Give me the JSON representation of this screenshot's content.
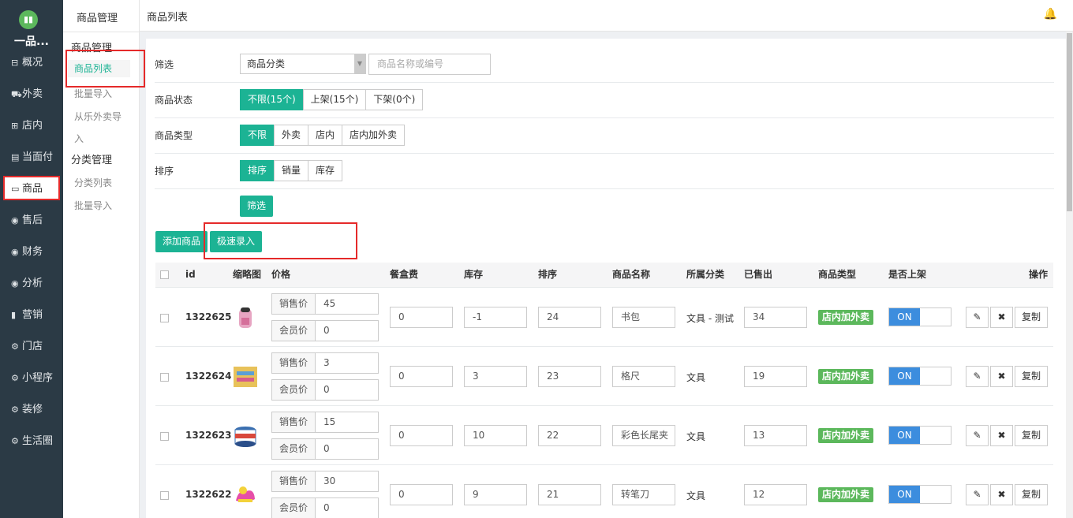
{
  "sidebar": {
    "logo_text": "▮▮",
    "brand": "一品...",
    "items": [
      {
        "icon": "⊟",
        "label": "概况"
      },
      {
        "icon": "⛟",
        "label": "外卖"
      },
      {
        "icon": "⊞",
        "label": "店内"
      },
      {
        "icon": "▤",
        "label": "当面付"
      },
      {
        "icon": "▭",
        "label": "商品"
      },
      {
        "icon": "◉",
        "label": "售后"
      },
      {
        "icon": "◉",
        "label": "财务"
      },
      {
        "icon": "◉",
        "label": "分析"
      },
      {
        "icon": "▮",
        "label": "营销"
      },
      {
        "icon": "⚙",
        "label": "门店"
      },
      {
        "icon": "⚙",
        "label": "小程序"
      },
      {
        "icon": "⚙",
        "label": "装修"
      },
      {
        "icon": "⚙",
        "label": "生活圈"
      }
    ]
  },
  "subnav": {
    "title": "商品管理",
    "group1": "商品管理",
    "active_item": "商品列表",
    "item_import": "批量导入",
    "item_from_lele_1": "从乐外卖导",
    "item_from_lele_2": "入",
    "group2": "分类管理",
    "item_category_list": "分类列表",
    "item_import2": "批量导入"
  },
  "topbar": {
    "title": "商品列表",
    "bell": "🔔"
  },
  "filters": {
    "filter_label": "筛选",
    "category_select": "商品分类",
    "search_placeholder": "商品名称或编号",
    "status_label": "商品状态",
    "status_options": [
      "不限(15个)",
      "上架(15个)",
      "下架(0个)"
    ],
    "type_label": "商品类型",
    "type_options": [
      "不限",
      "外卖",
      "店内",
      "店内加外卖"
    ],
    "sort_label": "排序",
    "sort_options": [
      "排序",
      "销量",
      "库存"
    ],
    "filter_button": "筛选"
  },
  "actions": {
    "add_product": "添加商品",
    "quick_entry": "极速录入"
  },
  "table": {
    "headers": {
      "id": "id",
      "thumb": "缩略图",
      "price": "价格",
      "box_fee": "餐盒费",
      "stock": "库存",
      "sort": "排序",
      "name": "商品名称",
      "category": "所属分类",
      "sold": "已售出",
      "type": "商品类型",
      "listed": "是否上架",
      "ops": "操作"
    },
    "sale_price_label": "销售价",
    "member_price_label": "会员价",
    "toggle_on": "ON",
    "copy_label": "复制",
    "edit_icon": "✎",
    "delete_icon": "✖",
    "rows": [
      {
        "id": "1322625",
        "sale_price": "45",
        "member_price": "0",
        "box_fee": "0",
        "stock": "-1",
        "sort": "24",
        "name": "书包",
        "category": "文具 - 测试",
        "sold": "34",
        "type": "店内加外卖"
      },
      {
        "id": "1322624",
        "sale_price": "3",
        "member_price": "0",
        "box_fee": "0",
        "stock": "3",
        "sort": "23",
        "name": "格尺",
        "category": "文具",
        "sold": "19",
        "type": "店内加外卖"
      },
      {
        "id": "1322623",
        "sale_price": "15",
        "member_price": "0",
        "box_fee": "0",
        "stock": "10",
        "sort": "22",
        "name": "彩色长尾夹",
        "category": "文具",
        "sold": "13",
        "type": "店内加外卖"
      },
      {
        "id": "1322622",
        "sale_price": "30",
        "member_price": "0",
        "box_fee": "0",
        "stock": "9",
        "sort": "21",
        "name": "转笔刀",
        "category": "文具",
        "sold": "12",
        "type": "店内加外卖"
      }
    ]
  }
}
